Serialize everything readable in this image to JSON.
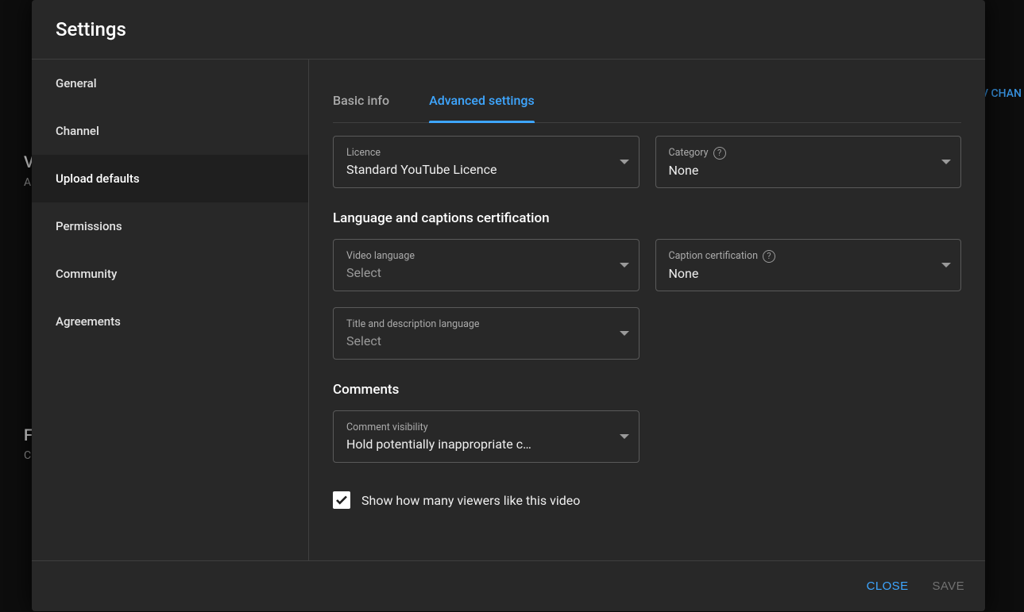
{
  "dialog": {
    "title": "Settings"
  },
  "sidebar": {
    "items": [
      {
        "label": "General"
      },
      {
        "label": "Channel"
      },
      {
        "label": "Upload defaults"
      },
      {
        "label": "Permissions"
      },
      {
        "label": "Community"
      },
      {
        "label": "Agreements"
      }
    ],
    "active_index": 2
  },
  "tabs": {
    "items": [
      {
        "label": "Basic info"
      },
      {
        "label": "Advanced settings"
      }
    ],
    "active_index": 1
  },
  "fields": {
    "licence": {
      "label": "Licence",
      "value": "Standard YouTube Licence"
    },
    "category": {
      "label": "Category",
      "value": "None",
      "help": true
    },
    "video_lang": {
      "label": "Video language",
      "value": "Select",
      "placeholder": true
    },
    "caption_cert": {
      "label": "Caption certification",
      "value": "None",
      "help": true
    },
    "title_desc_lang": {
      "label": "Title and description language",
      "value": "Select",
      "placeholder": true
    },
    "comment_vis": {
      "label": "Comment visibility",
      "value": "Hold potentially inappropriate c…"
    }
  },
  "sections": {
    "lang_caption": "Language and captions certification",
    "comments": "Comments"
  },
  "checkbox": {
    "show_likes": {
      "label": "Show how many viewers like this video",
      "checked": true
    }
  },
  "footer": {
    "close": "Close",
    "save": "Save"
  },
  "background": {
    "view_channel_fragment": "V CHAN",
    "left_letter_1": "V",
    "left_letter_2": "A",
    "left_title_2": "F",
    "left_sub_2": "C"
  }
}
